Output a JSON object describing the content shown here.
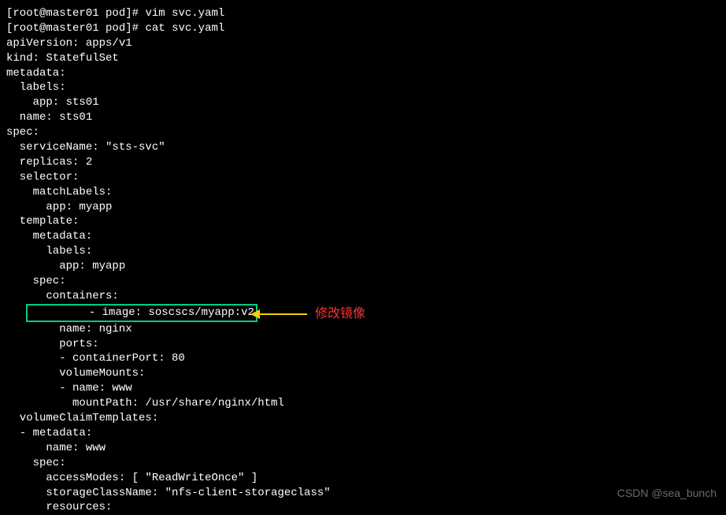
{
  "prompt": {
    "user_host": "root@master01",
    "cwd": "pod"
  },
  "commands": {
    "vim": "vim svc.yaml",
    "cat": "cat svc.yaml"
  },
  "yaml": {
    "l0": "apiVersion: apps/v1",
    "l1": "kind: StatefulSet",
    "l2": "metadata:",
    "l3": "  labels:",
    "l4": "    app: sts01",
    "l5": "  name: sts01",
    "l6": "spec:",
    "l7": "  serviceName: \"sts-svc\"",
    "l8": "  replicas: 2",
    "l9": "  selector:",
    "l10": "    matchLabels:",
    "l11": "      app: myapp",
    "l12": "  template:",
    "l13": "    metadata:",
    "l14": "      labels:",
    "l15": "        app: myapp",
    "l16": "    spec:",
    "l17": "      containers:",
    "l18": "      - image: soscscs/myapp:v2",
    "l19": "        name: nginx",
    "l20": "        ports:",
    "l21": "        - containerPort: 80",
    "l22": "        volumeMounts:",
    "l23": "        - name: www",
    "l24": "          mountPath: /usr/share/nginx/html",
    "l25": "  volumeClaimTemplates:",
    "l26": "  - metadata:",
    "l27": "      name: www",
    "l28": "    spec:",
    "l29": "      accessModes: [ \"ReadWriteOnce\" ]",
    "l30": "      storageClassName: \"nfs-client-storageclass\"",
    "l31": "      resources:"
  },
  "annotation": {
    "text": "修改镜像"
  },
  "watermark": "CSDN @sea_bunch"
}
